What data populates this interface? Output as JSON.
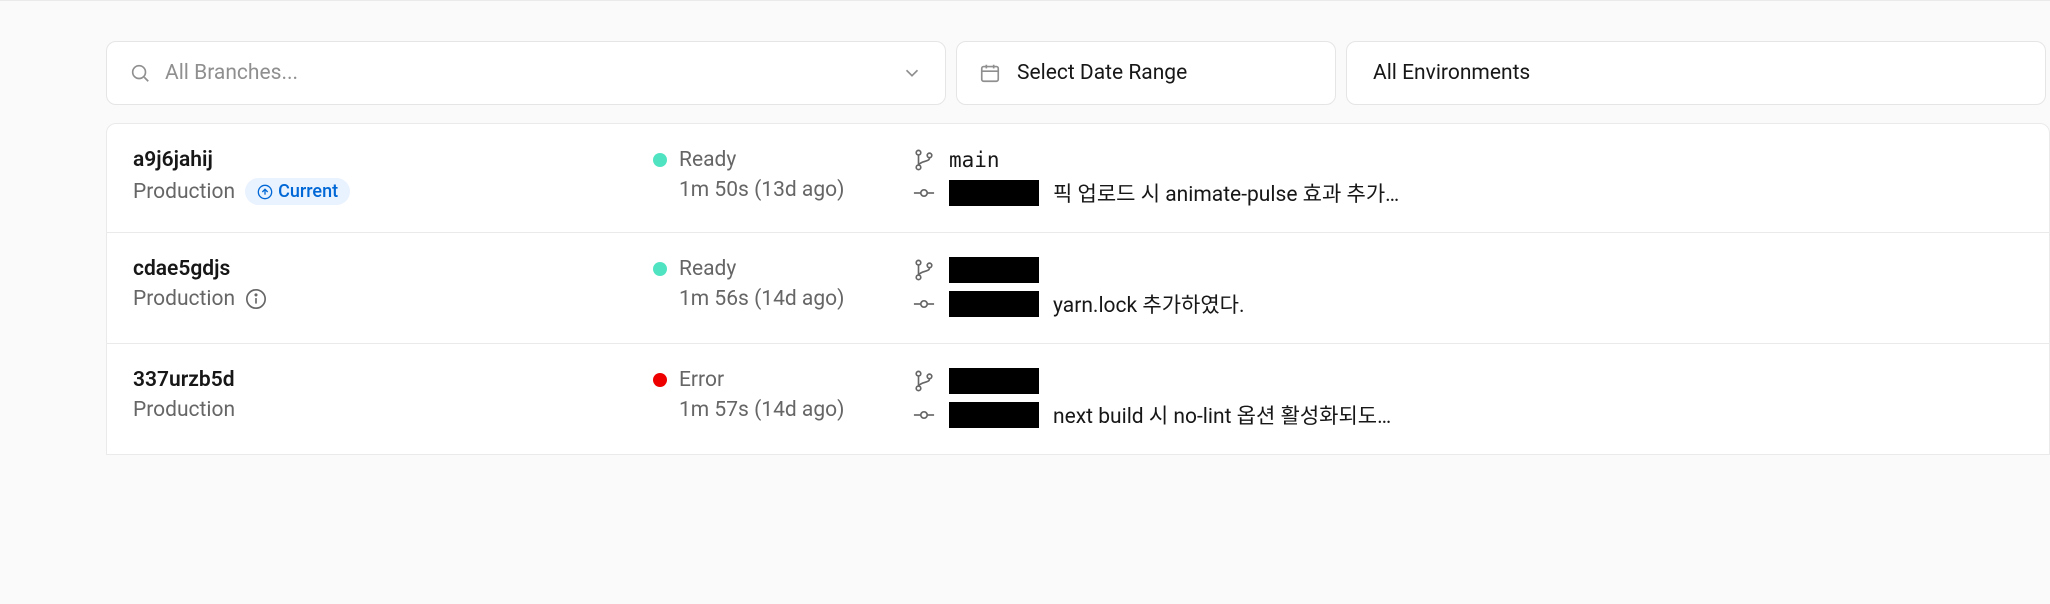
{
  "filters": {
    "branchPlaceholder": "All Branches...",
    "dateLabel": "Select Date Range",
    "envLabel": "All Environments"
  },
  "deployments": [
    {
      "id": "a9j6jahij",
      "env": "Production",
      "currentBadge": "Current",
      "showCurrent": true,
      "showInfo": false,
      "status": "Ready",
      "statusColor": "ready",
      "duration": "1m 50s (13d ago)",
      "branch": "main",
      "commitMessage": "픽 업로드 시 animate-pulse 효과 추가…"
    },
    {
      "id": "cdae5gdjs",
      "env": "Production",
      "showCurrent": false,
      "showInfo": true,
      "status": "Ready",
      "statusColor": "ready",
      "duration": "1m 56s (14d ago)",
      "branch": "",
      "commitMessage": "yarn.lock 추가하였다."
    },
    {
      "id": "337urzb5d",
      "env": "Production",
      "showCurrent": false,
      "showInfo": false,
      "status": "Error",
      "statusColor": "error",
      "duration": "1m 57s (14d ago)",
      "branch": "",
      "commitMessage": "next build 시 no-lint 옵션 활성화되도…"
    }
  ]
}
